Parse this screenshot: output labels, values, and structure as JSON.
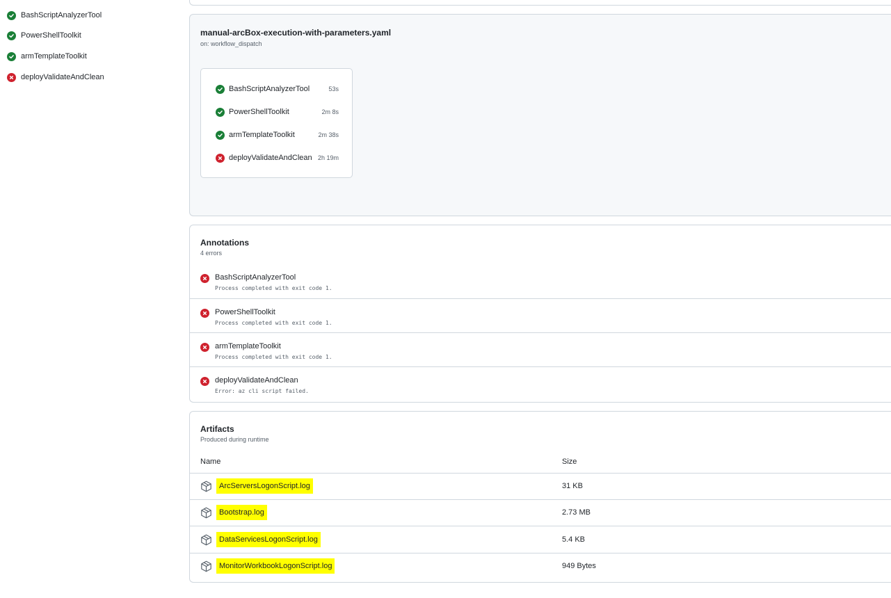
{
  "sidebar": {
    "jobs": [
      {
        "name": "BashScriptAnalyzerTool",
        "status": "success"
      },
      {
        "name": "PowerShellToolkit",
        "status": "success"
      },
      {
        "name": "armTemplateToolkit",
        "status": "success"
      },
      {
        "name": "deployValidateAndClean",
        "status": "failure"
      }
    ]
  },
  "workflow": {
    "file": "manual-arcBox-execution-with-parameters.yaml",
    "trigger": "on: workflow_dispatch",
    "jobs": [
      {
        "name": "BashScriptAnalyzerTool",
        "duration": "53s",
        "status": "success"
      },
      {
        "name": "PowerShellToolkit",
        "duration": "2m 8s",
        "status": "success"
      },
      {
        "name": "armTemplateToolkit",
        "duration": "2m 38s",
        "status": "success"
      },
      {
        "name": "deployValidateAndClean",
        "duration": "2h 19m",
        "status": "failure"
      }
    ]
  },
  "annotations": {
    "title": "Annotations",
    "count": "4 errors",
    "items": [
      {
        "job": "BashScriptAnalyzerTool",
        "message": "Process completed with exit code 1."
      },
      {
        "job": "PowerShellToolkit",
        "message": "Process completed with exit code 1."
      },
      {
        "job": "armTemplateToolkit",
        "message": "Process completed with exit code 1."
      },
      {
        "job": "deployValidateAndClean",
        "message": "Error: az cli script failed."
      }
    ]
  },
  "artifacts": {
    "title": "Artifacts",
    "subtitle": "Produced during runtime",
    "columns": {
      "name": "Name",
      "size": "Size"
    },
    "items": [
      {
        "name": "ArcServersLogonScript.log",
        "size": "31 KB"
      },
      {
        "name": "Bootstrap.log",
        "size": "2.73 MB"
      },
      {
        "name": "DataServicesLogonScript.log",
        "size": "5.4 KB"
      },
      {
        "name": "MonitorWorkbookLogonScript.log",
        "size": "949 Bytes"
      }
    ]
  },
  "colors": {
    "success": "#1a7f37",
    "failure": "#cf222e",
    "highlight": "#ffff00",
    "border": "#d0d7de",
    "panel_bg": "#f6f8fa"
  },
  "icons": {
    "success": "check-circle-fill-icon",
    "failure": "x-circle-fill-icon",
    "artifact": "package-icon"
  }
}
